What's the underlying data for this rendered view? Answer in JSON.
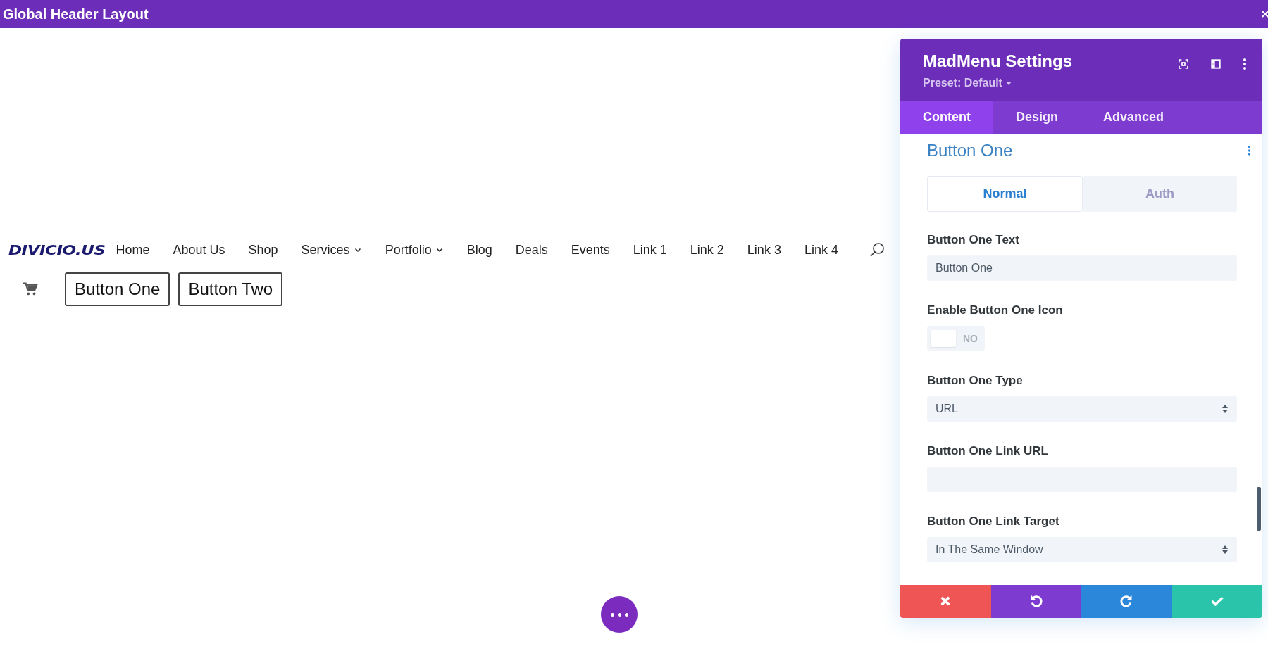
{
  "window": {
    "title": "Global Header Layout"
  },
  "header": {
    "logo": "DIVICIO.US",
    "nav": [
      {
        "label": "Home",
        "dropdown": false
      },
      {
        "label": "About Us",
        "dropdown": false
      },
      {
        "label": "Shop",
        "dropdown": false
      },
      {
        "label": "Services",
        "dropdown": true
      },
      {
        "label": "Portfolio",
        "dropdown": true
      },
      {
        "label": "Blog",
        "dropdown": false
      },
      {
        "label": "Deals",
        "dropdown": false
      },
      {
        "label": "Events",
        "dropdown": false
      },
      {
        "label": "Link 1",
        "dropdown": false
      },
      {
        "label": "Link 2",
        "dropdown": false
      },
      {
        "label": "Link 3",
        "dropdown": false
      },
      {
        "label": "Link 4",
        "dropdown": false
      }
    ],
    "buttons": [
      "Button One",
      "Button Two"
    ]
  },
  "settings": {
    "title": "MadMenu Settings",
    "preset": "Preset: Default",
    "tabs": [
      {
        "label": "Content",
        "selected": true
      },
      {
        "label": "Design",
        "selected": false
      },
      {
        "label": "Advanced",
        "selected": false
      }
    ],
    "section": "Button One",
    "states": [
      {
        "label": "Normal",
        "selected": true
      },
      {
        "label": "Auth",
        "selected": false
      }
    ],
    "fields": [
      {
        "kind": "text",
        "label": "Button One Text",
        "value": "Button One"
      },
      {
        "kind": "toggle",
        "label": "Enable Button One Icon",
        "on": false,
        "value": "NO"
      },
      {
        "kind": "select",
        "label": "Button One Type",
        "value": "URL"
      },
      {
        "kind": "text",
        "label": "Button One Link URL"
      },
      {
        "kind": "select",
        "label": "Button One Link Target",
        "value": "In The Same Window"
      }
    ],
    "actions": [
      {
        "kind": "cancel",
        "color": "#ef5555"
      },
      {
        "kind": "undo",
        "color": "#7e3bd0"
      },
      {
        "kind": "redo",
        "color": "#2b87da"
      },
      {
        "kind": "save",
        "color": "#29c4a9"
      }
    ]
  }
}
